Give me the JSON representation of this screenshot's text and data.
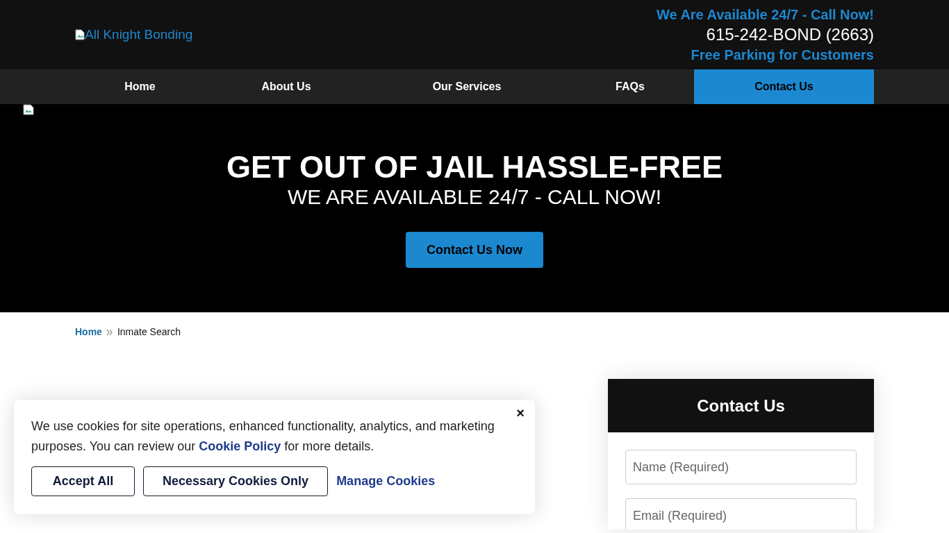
{
  "header": {
    "logo_alt": "All Knight Bonding",
    "availability": "We Are Available 24/7 - Call Now!",
    "phone": "615-242-BOND (2663)",
    "parking": "Free Parking for Customers"
  },
  "nav": [
    {
      "label": "Home",
      "selected": false
    },
    {
      "label": "About Us",
      "selected": false
    },
    {
      "label": "Our Services",
      "selected": false
    },
    {
      "label": "FAQs",
      "selected": false
    },
    {
      "label": "Contact Us",
      "selected": true
    }
  ],
  "hero": {
    "title": "GET OUT OF JAIL HASSLE-FREE",
    "subtitle": "WE ARE AVAILABLE 24/7 - CALL NOW!",
    "button": "Contact Us Now"
  },
  "breadcrumb": [
    {
      "label": "Home",
      "kind": "link"
    },
    {
      "label": "Inmate Search",
      "kind": "current"
    }
  ],
  "sidebar": {
    "title": "Contact Us",
    "fields": [
      {
        "placeholder": "Name (Required)"
      },
      {
        "placeholder": "Email (Required)"
      }
    ]
  },
  "cookie_banner": {
    "close": "×",
    "text": "We use cookies for site operations, enhanced functionality, analytics, and marketing purposes. You can review our **Cookie Policy** for more details.",
    "buttons": [
      {
        "label": "Accept All",
        "kind": "outline"
      },
      {
        "label": "Necessary Cookies Only",
        "kind": "outline"
      },
      {
        "label": "Manage Cookies",
        "kind": "link"
      }
    ]
  }
}
